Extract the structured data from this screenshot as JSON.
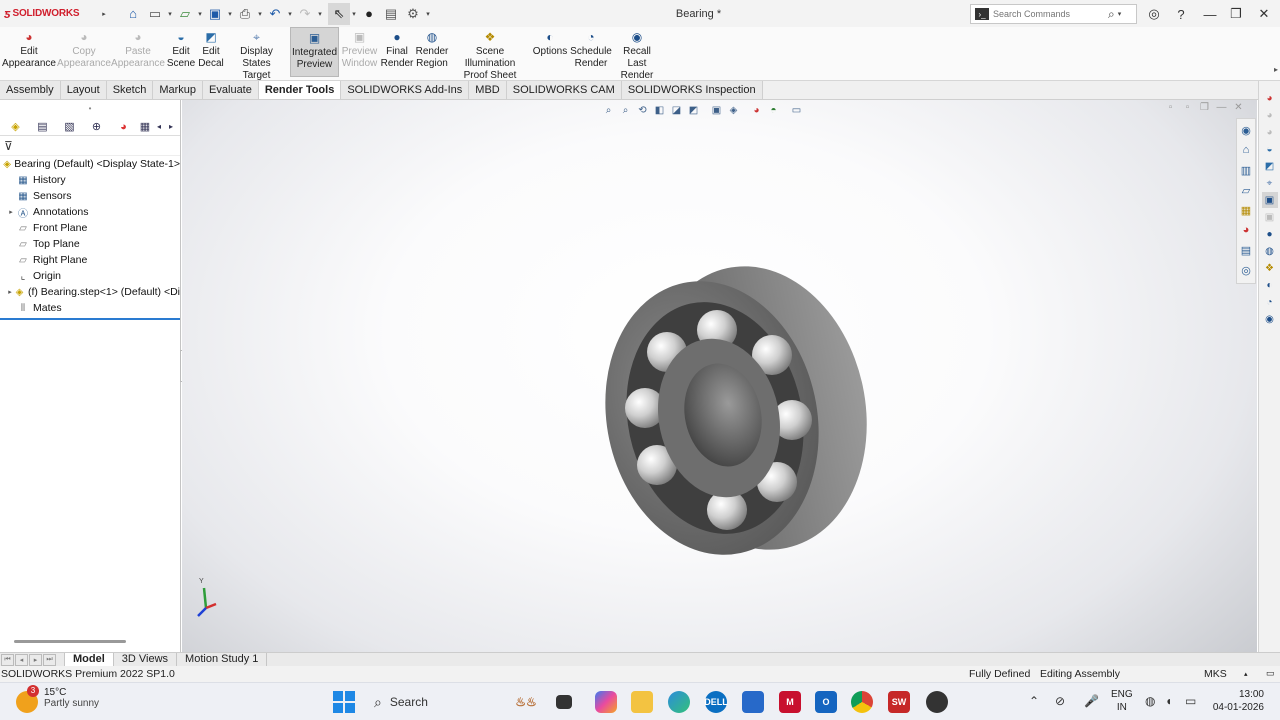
{
  "app": {
    "logo_text": "SOLIDWORKS",
    "doc_title": "Bearing *"
  },
  "quick_access": {
    "icons": [
      "home-icon",
      "new-icon",
      "open-icon",
      "save-icon",
      "print-icon",
      "undo-icon",
      "redo-icon",
      "select-icon",
      "rebuild-icon",
      "file-properties-icon",
      "options-icon"
    ]
  },
  "search": {
    "placeholder": "Search Commands"
  },
  "command_manager": {
    "buttons": [
      {
        "label1": "Edit",
        "label2": "Appearance",
        "state": "normal",
        "icon": "appearance-icon"
      },
      {
        "label1": "Copy",
        "label2": "Appearance",
        "state": "disabled",
        "icon": "copy-appearance-icon"
      },
      {
        "label1": "Paste",
        "label2": "Appearance",
        "state": "disabled",
        "icon": "paste-appearance-icon"
      },
      {
        "label1": "Edit",
        "label2": "Scene",
        "state": "normal",
        "icon": "scene-icon"
      },
      {
        "label1": "Edit",
        "label2": "Decal",
        "state": "normal",
        "icon": "decal-icon"
      },
      {
        "label1": "Display States",
        "label2": "Target",
        "state": "normal",
        "icon": "display-states-icon"
      },
      {
        "label1": "Integrated",
        "label2": "Preview",
        "state": "active",
        "icon": "integrated-preview-icon"
      },
      {
        "label1": "Preview",
        "label2": "Window",
        "state": "disabled",
        "icon": "preview-window-icon"
      },
      {
        "label1": "Final",
        "label2": "Render",
        "state": "normal",
        "icon": "final-render-icon"
      },
      {
        "label1": "Render",
        "label2": "Region",
        "state": "normal",
        "icon": "render-region-icon"
      },
      {
        "label1": "Scene Illumination",
        "label2": "Proof Sheet",
        "state": "normal",
        "icon": "proof-sheet-icon"
      },
      {
        "label1": "Options",
        "label2": "",
        "state": "normal",
        "icon": "options-icon"
      },
      {
        "label1": "Schedule",
        "label2": "Render",
        "state": "normal",
        "icon": "schedule-render-icon"
      },
      {
        "label1": "Recall Last",
        "label2": "Render",
        "state": "normal",
        "icon": "recall-render-icon"
      }
    ]
  },
  "tabs": [
    "Assembly",
    "Layout",
    "Sketch",
    "Markup",
    "Evaluate",
    "Render Tools",
    "SOLIDWORKS Add-Ins",
    "MBD",
    "SOLIDWORKS CAM",
    "SOLIDWORKS Inspection"
  ],
  "active_tab": "Render Tools",
  "feature_tree": {
    "root": "Bearing (Default) <Display State-1>",
    "items": [
      {
        "label": "History",
        "expandable": false,
        "icon": "history-icon"
      },
      {
        "label": "Sensors",
        "expandable": false,
        "icon": "sensors-icon"
      },
      {
        "label": "Annotations",
        "expandable": true,
        "icon": "annotations-icon"
      },
      {
        "label": "Front Plane",
        "expandable": false,
        "icon": "plane-icon"
      },
      {
        "label": "Top Plane",
        "expandable": false,
        "icon": "plane-icon"
      },
      {
        "label": "Right Plane",
        "expandable": false,
        "icon": "plane-icon"
      },
      {
        "label": "Origin",
        "expandable": false,
        "icon": "origin-icon"
      },
      {
        "label": "(f) Bearing.step<1> (Default) <Di",
        "expandable": true,
        "icon": "part-icon"
      },
      {
        "label": "Mates",
        "expandable": false,
        "icon": "mates-icon"
      }
    ]
  },
  "triad": {
    "y_label": "Y"
  },
  "bottom_tabs": [
    "Model",
    "3D Views",
    "Motion Study 1"
  ],
  "active_bottom_tab": "Model",
  "status": {
    "version": "SOLIDWORKS Premium 2022 SP1.0",
    "defined": "Fully Defined",
    "mode": "Editing Assembly",
    "units": "MKS"
  },
  "taskbar": {
    "weather_badge": "3",
    "temp": "15°C",
    "condition": "Partly sunny",
    "search_label": "Search",
    "lang1": "ENG",
    "lang2": "IN",
    "time": "13:00",
    "date": "04-01-2026"
  },
  "colors": {
    "accent": "#2a7bd1",
    "brand_red": "#d01f2d",
    "active_tab_bg": "#ffffff"
  }
}
